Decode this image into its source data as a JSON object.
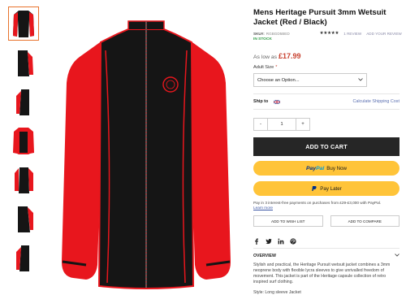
{
  "product": {
    "title": "Mens Heritage Pursuit 3mm Wetsuit Jacket (Red / Black)",
    "sku_label": "SKU#:",
    "sku_value": "RGBGD5BED",
    "stars": "★★★★★",
    "review_count": "1 REVIEW",
    "add_review": "ADD YOUR REVIEW",
    "stock": "IN STOCK",
    "price_prefix": "As low as",
    "price": "£17.99"
  },
  "options": {
    "size_label": "Adult Size",
    "required_mark": "*",
    "size_placeholder": "Choose an Option..."
  },
  "shipping": {
    "label": "Ship to",
    "calculate": "Calculate Shipping Cost"
  },
  "quantity": {
    "minus": "-",
    "value": "1",
    "plus": "+"
  },
  "buttons": {
    "add_to_cart": "ADD TO CART",
    "paypal_pay": "Pay",
    "paypal_pal": "Pal",
    "paypal_buy_now": "Buy Now",
    "pay_later": "Pay Later",
    "wish_list": "ADD TO WISH LIST",
    "compare": "ADD TO COMPARE"
  },
  "interest": {
    "text": "Pay in 3 interest-free payments on purchases from £29-£3,000 with PayPal.",
    "learn_more": "Learn more"
  },
  "social": [
    "facebook-icon",
    "twitter-icon",
    "linkedin-icon",
    "pinterest-icon"
  ],
  "overview": {
    "heading": "OVERVIEW",
    "description": "Stylish and practical, the Heritage Pursuit wetsuit jacket combines a 3mm neoprene body with flexible lycra sleeves to give unrivalled freedom of movement. This jacket is part of the Heritage capsule collection of retro inspired surf clothing.",
    "style": "Style: Long sleeve Jacket"
  },
  "colors": {
    "accent_red": "#c8412f",
    "paypal_yellow": "#ffc439",
    "cart_dark": "#262626",
    "jacket_red": "#e8161d",
    "jacket_black": "#151515"
  }
}
